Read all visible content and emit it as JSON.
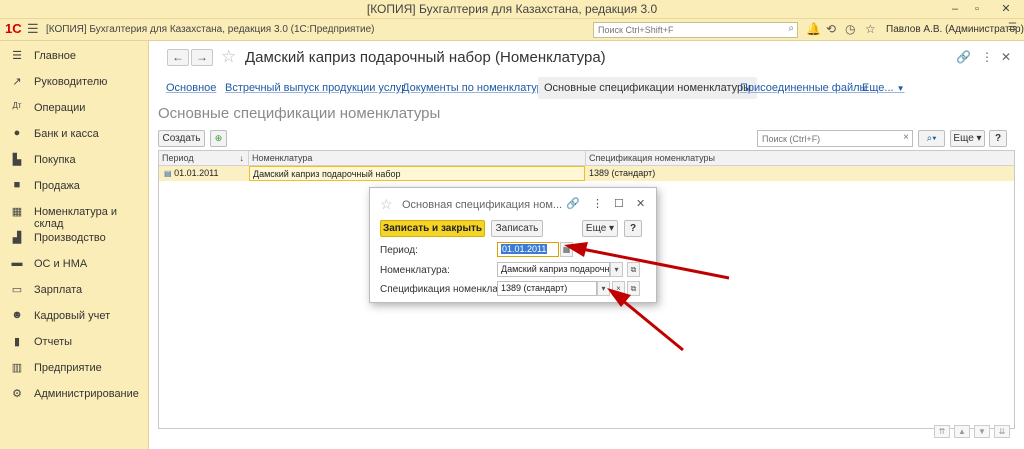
{
  "window": {
    "title": "[КОПИЯ] Бухгалтерия для Казахстана, редакция 3.0",
    "app_title": "[КОПИЯ] Бухгалтерия для Казахстана, редакция 3.0  (1С:Предприятие)",
    "logo": "1С",
    "search_placeholder": "Поиск Ctrl+Shift+F",
    "user": "Павлов А.В. (Администратор)"
  },
  "sidebar": {
    "items": [
      {
        "label": "Главное",
        "icon": "menu-icon"
      },
      {
        "label": "Руководителю",
        "icon": "trend-icon"
      },
      {
        "label": "Операции",
        "icon": "dt-kt-icon"
      },
      {
        "label": "Банк и касса",
        "icon": "coins-icon"
      },
      {
        "label": "Покупка",
        "icon": "cart-icon"
      },
      {
        "label": "Продажа",
        "icon": "bag-icon"
      },
      {
        "label": "Номенклатура и склад",
        "icon": "grid-icon"
      },
      {
        "label": "Производство",
        "icon": "factory-icon"
      },
      {
        "label": "ОС и НМА",
        "icon": "truck-icon"
      },
      {
        "label": "Зарплата",
        "icon": "wallet-icon"
      },
      {
        "label": "Кадровый учет",
        "icon": "people-icon"
      },
      {
        "label": "Отчеты",
        "icon": "chart-icon"
      },
      {
        "label": "Предприятие",
        "icon": "building-icon"
      },
      {
        "label": "Администрирование",
        "icon": "gear-icon"
      }
    ]
  },
  "document": {
    "title": "Дамский каприз подарочный набор (Номенклатура)",
    "tabs": [
      "Основное",
      "Встречный выпуск продукции услуг",
      "Документы по номенклатуре",
      "Основные спецификации номенклатуры",
      "Присоединенные файлы",
      "Еще..."
    ],
    "section_title": "Основные спецификации номенклатуры",
    "create_label": "Создать",
    "list_search_placeholder": "Поиск (Ctrl+F)",
    "more_label": "Еще",
    "help_label": "?"
  },
  "grid": {
    "columns": [
      "Период",
      "Номенклатура",
      "Спецификация номенклатуры"
    ],
    "rows": [
      {
        "period": "01.01.2011",
        "item": "Дамский каприз подарочный набор",
        "spec": "1389 (стандарт)"
      }
    ]
  },
  "dialog": {
    "title": "Основная спецификация ном...",
    "save_close_label": "Записать и закрыть",
    "save_label": "Записать",
    "more_label": "Еще",
    "help_label": "?",
    "period_label": "Период:",
    "period_value": "01.01.2011",
    "nomen_label": "Номенклатура:",
    "nomen_value": "Дамский каприз подарочны",
    "spec_label": "Спецификация номенклатуры:",
    "spec_value": "1389 (стандарт)"
  },
  "colors": {
    "sidebar_bg": "#fbedb8",
    "accent_yellow": "#f5d428",
    "arrow_red": "#c00000",
    "link_blue": "#1f5aa8"
  }
}
